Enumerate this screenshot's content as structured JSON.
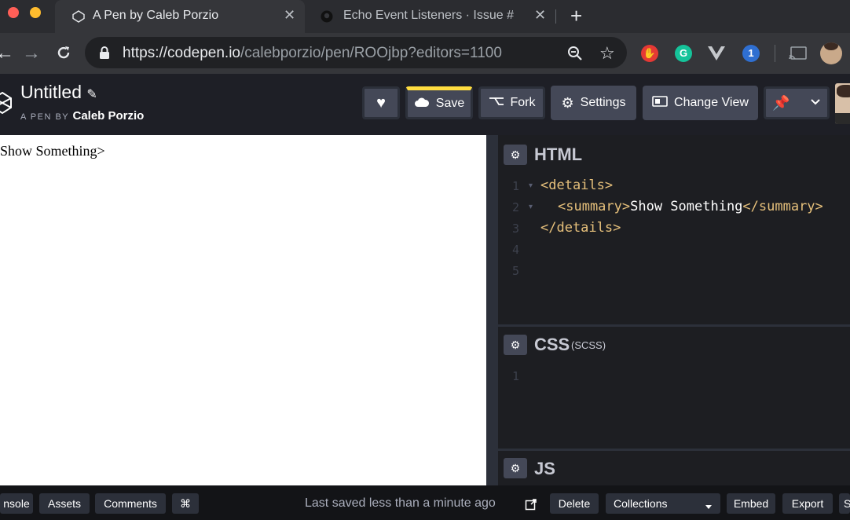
{
  "browser": {
    "tabs": [
      {
        "title": "A Pen by Caleb Porzio",
        "active": true
      },
      {
        "title": "Echo Event Listeners · Issue #",
        "active": false
      }
    ],
    "url_host": "https://codepen.io",
    "url_path": "/calebporzio/pen/ROOjbp?editors=1100",
    "traffic_colors": [
      "#ff5f57",
      "#febc2e",
      "#28c840"
    ]
  },
  "codepen": {
    "pen_title": "Untitled",
    "byline_prefix": "A PEN BY",
    "author": "Caleb Porzio",
    "buttons": {
      "save": "Save",
      "fork": "Fork",
      "settings": "Settings",
      "change_view": "Change View"
    },
    "accent_color": "#ffdd40"
  },
  "preview": {
    "text": "Show Something>"
  },
  "editors": {
    "html": {
      "title": "HTML",
      "lines": [
        "1",
        "2",
        "3",
        "4",
        "5"
      ],
      "code": {
        "open_details": "<details>",
        "open_summary": "<summary>",
        "summary_text": "Show Something",
        "close_summary": "</summary>",
        "close_details": "</details>"
      }
    },
    "css": {
      "title": "CSS",
      "subtitle": "(SCSS)",
      "lines": [
        "1"
      ]
    },
    "js": {
      "title": "JS"
    }
  },
  "footer": {
    "console": "nsole",
    "assets": "Assets",
    "comments": "Comments",
    "shortcut": "⌘",
    "saved_status": "Last saved less than a minute ago",
    "delete": "Delete",
    "collections": "Collections",
    "embed": "Embed",
    "export": "Export",
    "share": "S"
  }
}
